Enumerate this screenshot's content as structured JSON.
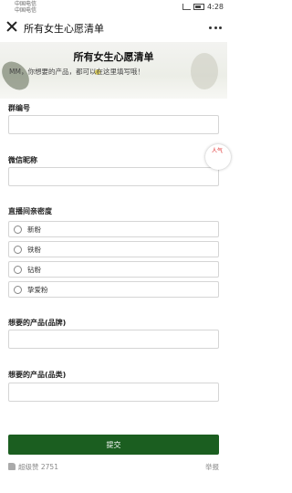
{
  "status_bar": {
    "carrier_line1": "中国电信",
    "carrier_line2": "中国电信",
    "time": "4:28"
  },
  "nav": {
    "title": "所有女生心愿清单"
  },
  "form": {
    "title": "所有女生心愿清单",
    "description": "MM，你想要的产品，都可以在这里填写哦！",
    "fields": [
      {
        "label": "群编号",
        "value": ""
      },
      {
        "label": "微信昵称",
        "value": ""
      }
    ],
    "density": {
      "label": "直播间亲密度",
      "options": [
        "新粉",
        "铁粉",
        "钻粉",
        "挚爱粉"
      ]
    },
    "brand": {
      "label": "想要的产品(品牌)",
      "value": ""
    },
    "category": {
      "label": "想要的产品(品类)",
      "value": ""
    },
    "submit_label": "提交"
  },
  "floating_badge": {
    "text": "人气"
  },
  "footer": {
    "likes": "超级赞 2751",
    "report": "举报"
  }
}
